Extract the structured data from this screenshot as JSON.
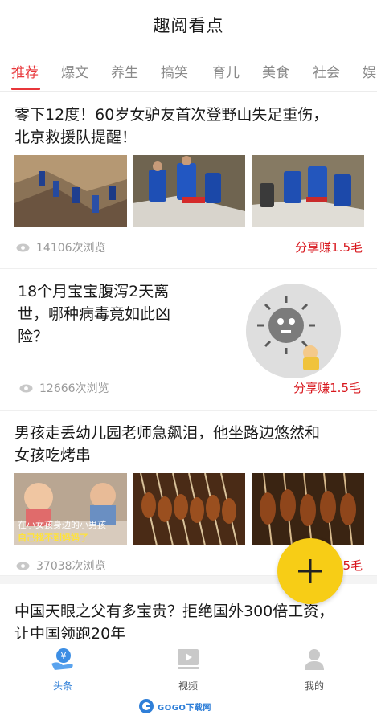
{
  "header": {
    "title": "趣阅看点"
  },
  "tabs": [
    {
      "label": "推荐",
      "active": true
    },
    {
      "label": "爆文"
    },
    {
      "label": "养生"
    },
    {
      "label": "搞笑"
    },
    {
      "label": "育儿"
    },
    {
      "label": "美食"
    },
    {
      "label": "社会"
    },
    {
      "label": "娱"
    }
  ],
  "articles": [
    {
      "title_line1": "零下12度！60岁女驴友首次登野山失足重伤，",
      "title_line2": "北京救援队提醒！",
      "views": "14106次浏览",
      "share": "分享赚1.5毛"
    },
    {
      "title_line1": "18个月宝宝腹泻2天离",
      "title_line2": "世，哪种病毒竟如此凶",
      "title_line3": "险？",
      "views": "12666次浏览",
      "share": "分享赚1.5毛"
    },
    {
      "title_line1": "男孩走丢幼儿园老师急飙泪，他坐路边悠然和",
      "title_line2": "女孩吃烤串",
      "views": "37038次浏览",
      "share": "5毛",
      "thumb_caption_1": "在小女孩身边的小男孩",
      "thumb_caption_2": "自己找不到妈妈了"
    },
    {
      "title_line1": "中国天眼之父有多宝贵？拒绝国外300倍工资，",
      "title_line2": "让中国领跑20年"
    }
  ],
  "fab": {
    "icon": "plus-icon"
  },
  "bottom_nav": [
    {
      "label": "头条",
      "icon": "yuan-hand-icon",
      "active": true
    },
    {
      "label": "视频",
      "icon": "video-icon"
    },
    {
      "label": "我的",
      "icon": "user-icon"
    }
  ],
  "watermark": {
    "text": "GOGO下载网"
  },
  "colors": {
    "accent": "#e8363a",
    "share": "#d8161c",
    "fab": "#f7cd16",
    "nav_active": "#2f7fd8"
  }
}
